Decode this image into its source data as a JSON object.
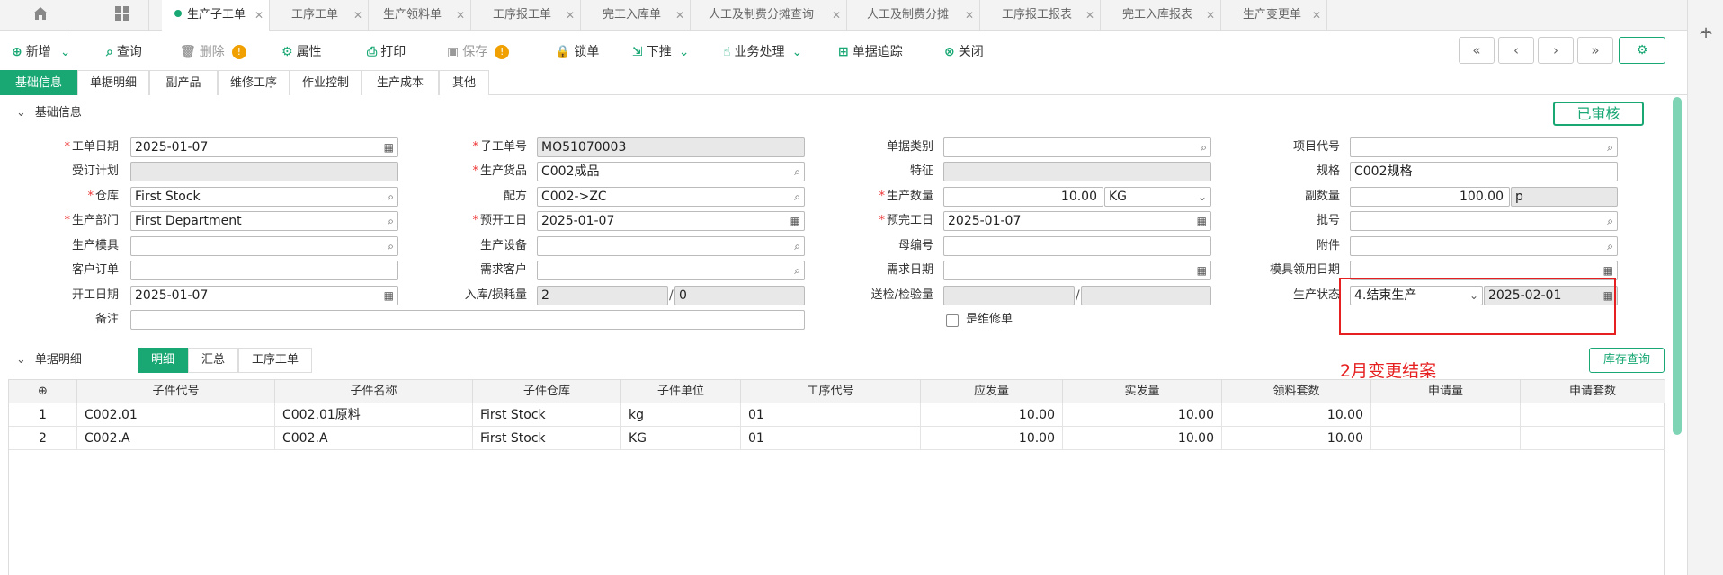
{
  "tabs": [
    {
      "label": "生产子工单",
      "active": true
    },
    {
      "label": "工序工单"
    },
    {
      "label": "生产领料单"
    },
    {
      "label": "工序报工单"
    },
    {
      "label": "完工入库单"
    },
    {
      "label": "人工及制费分摊查询"
    },
    {
      "label": "人工及制费分摊"
    },
    {
      "label": "工序报工报表"
    },
    {
      "label": "完工入库报表"
    },
    {
      "label": "生产变更单"
    }
  ],
  "toolbar": {
    "new": "新增",
    "query": "查询",
    "delete": "删除",
    "attr": "属性",
    "print": "打印",
    "save": "保存",
    "lock": "锁单",
    "push": "下推",
    "biz": "业务处理",
    "trace": "单据追踪",
    "close": "关闭"
  },
  "subtabs": [
    "基础信息",
    "单据明细",
    "副产品",
    "维修工序",
    "作业控制",
    "生产成本",
    "其他"
  ],
  "section_basic": "基础信息",
  "status_badge": "已审核",
  "form": {
    "labels": {
      "work_date": "工单日期",
      "sub_no": "子工单号",
      "doc_type": "单据类别",
      "project_code": "项目代号",
      "order_plan": "受订计划",
      "product": "生产货品",
      "feature": "特征",
      "spec": "规格",
      "warehouse": "仓库",
      "recipe": "配方",
      "qty": "生产数量",
      "sub_qty": "副数量",
      "dept": "生产部门",
      "plan_start": "预开工日",
      "plan_end": "预完工日",
      "batch": "批号",
      "mold": "生产模具",
      "equipment": "生产设备",
      "parent_no": "母编号",
      "attach": "附件",
      "cust_order": "客户订单",
      "demand_cust": "需求客户",
      "demand_date": "需求日期",
      "mold_date": "模具领用日期",
      "start_date": "开工日期",
      "in_loss": "入库/损耗量",
      "inspect": "送检/检验量",
      "prod_status": "生产状态",
      "remark": "备注",
      "repair": "是维修单"
    },
    "values": {
      "work_date": "2025-01-07",
      "sub_no": "MO51070003",
      "product": "C002成品",
      "spec": "C002规格",
      "warehouse": "First Stock",
      "recipe": "C002->ZC",
      "qty": "10.00",
      "qty_unit": "KG",
      "sub_qty": "100.00",
      "sub_unit": "p",
      "dept": "First Department",
      "plan_start": "2025-01-07",
      "plan_end": "2025-01-07",
      "start_date": "2025-01-07",
      "in_qty": "2",
      "loss_qty": "0",
      "prod_status": "4.结束生产",
      "status_date": "2025-02-01"
    }
  },
  "annotation": "2月变更结案",
  "section_detail": "单据明细",
  "detail_tabs": [
    "明细",
    "汇总",
    "工序工单"
  ],
  "stock_query": "库存查询",
  "grid": {
    "add_icon": "⊕",
    "headers": [
      "子件代号",
      "子件名称",
      "子件仓库",
      "子件单位",
      "工序代号",
      "应发量",
      "实发量",
      "领料套数",
      "申请量",
      "申请套数"
    ],
    "rows": [
      [
        "1",
        "C002.01",
        "C002.01原料",
        "First Stock",
        "kg",
        "01",
        "10.00",
        "10.00",
        "10.00",
        "",
        ""
      ],
      [
        "2",
        "C002.A",
        "C002.A",
        "First Stock",
        "KG",
        "01",
        "10.00",
        "10.00",
        "10.00",
        "",
        ""
      ]
    ]
  },
  "colors": {
    "accent": "#19a874",
    "annotation": "#e62020",
    "warn": "#f0a000"
  }
}
